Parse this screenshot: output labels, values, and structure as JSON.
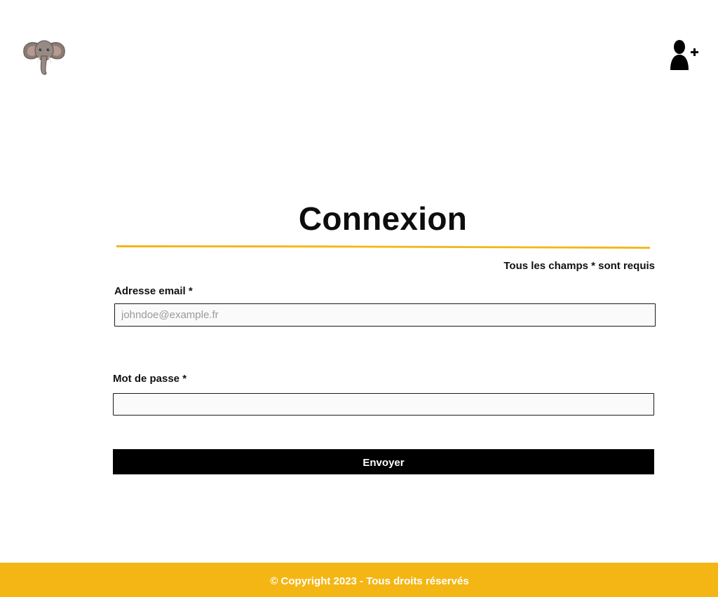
{
  "header": {
    "logo_icon": "elephant-logo-icon",
    "signup_icon": "user-plus-icon"
  },
  "login_form": {
    "title": "Connexion",
    "required_note": "Tous les champs * sont requis",
    "email": {
      "label": "Adresse email *",
      "value": "",
      "placeholder": "johndoe@example.fr"
    },
    "password": {
      "label": "Mot de passe *",
      "value": "",
      "placeholder": ""
    },
    "submit_label": "Envoyer"
  },
  "footer": {
    "copyright": "© Copyright 2023 - Tous droits réservés"
  },
  "colors": {
    "accent": "#f4b614",
    "button": "#000000",
    "text": "#111111",
    "input_bg": "#fafafa"
  }
}
